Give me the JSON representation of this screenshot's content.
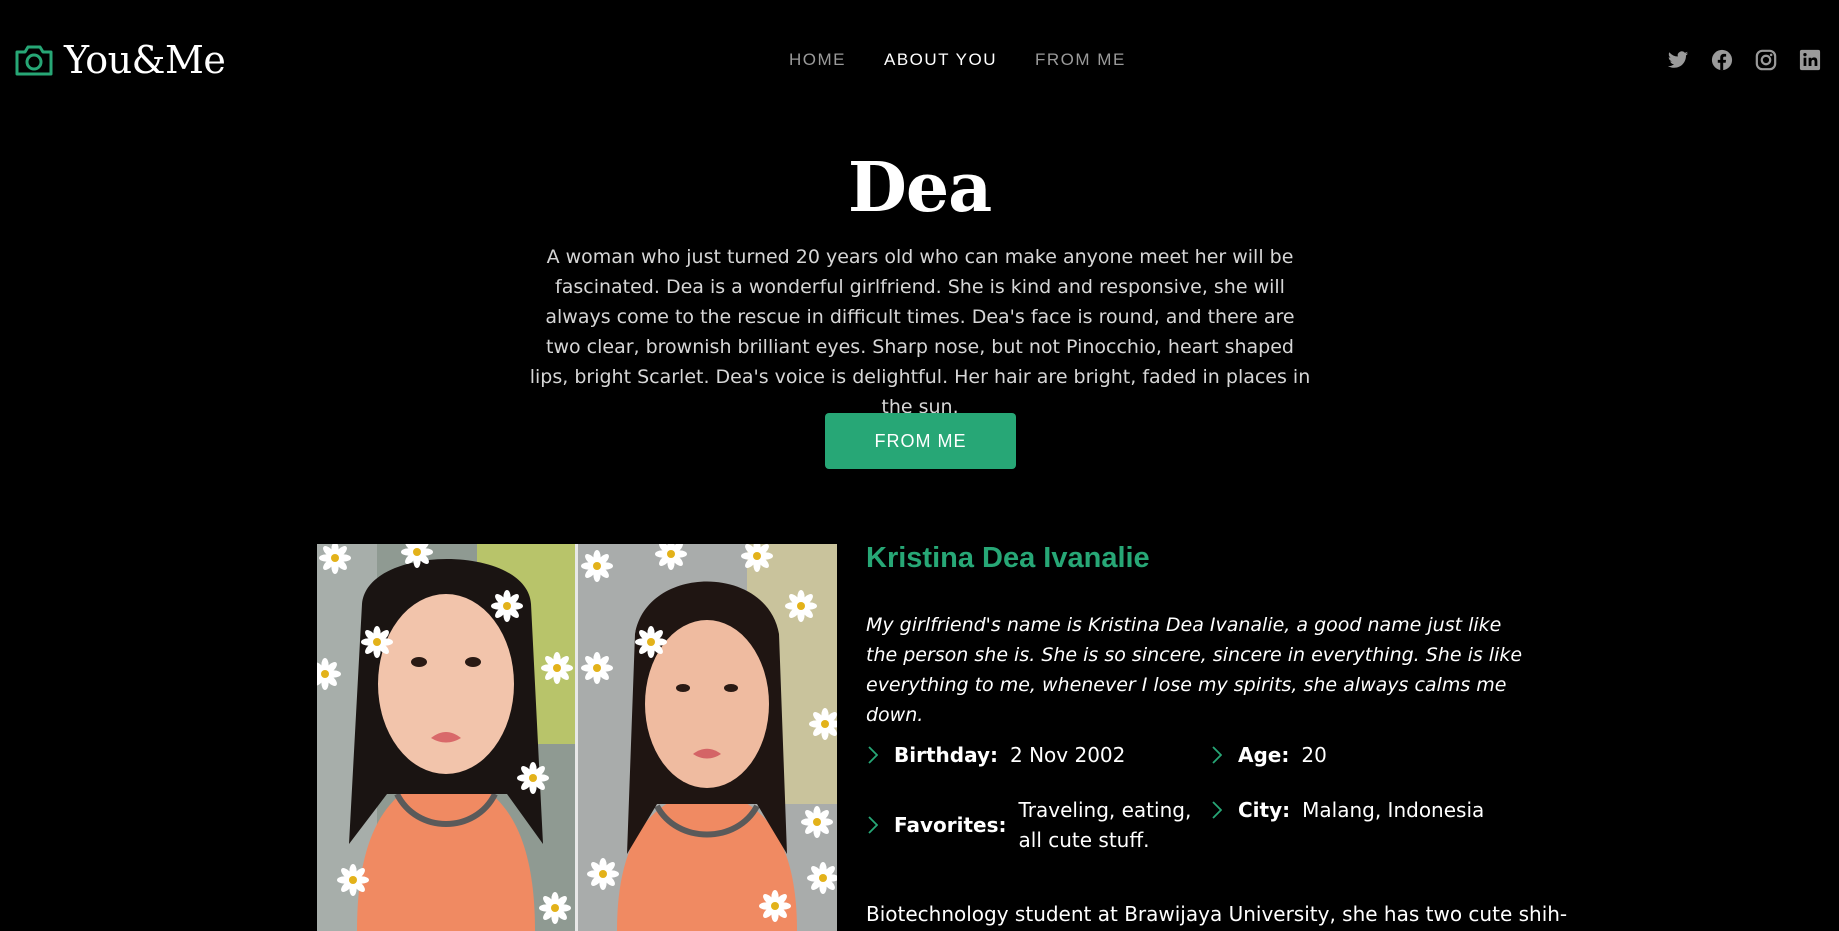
{
  "brand": {
    "name": "You&Me",
    "icon": "camera-icon",
    "accent": "#27a776"
  },
  "nav": {
    "items": [
      "HOME",
      "ABOUT YOU",
      "FROM ME"
    ],
    "active": "ABOUT YOU"
  },
  "socials": [
    "twitter-icon",
    "facebook-icon",
    "instagram-icon",
    "linkedin-icon"
  ],
  "hero": {
    "title": "Dea",
    "description": "A woman who just turned 20 years old who can make anyone meet her will be fascinated. Dea is a wonderful girlfriend. She is kind and responsive, she will always come to the rescue in difficult times. Dea's face is round, and there are two clear, brownish brilliant eyes. Sharp nose, but not Pinocchio, heart shaped lips, bright Scarlet. Dea's voice is delightful. Her hair are bright, faded in places in the sun.",
    "cta_label": "FROM ME"
  },
  "profile": {
    "name": "Kristina Dea Ivanalie",
    "bio": "My girlfriend's name is Kristina Dea Ivanalie, a good name just like the person she is. She is so sincere, sincere in everything. She is like everything to me, whenever I lose my spirits, she always calms me down.",
    "details": {
      "birthday": {
        "label": "Birthday:",
        "value": "2 Nov 2002"
      },
      "age": {
        "label": "Age:",
        "value": "20"
      },
      "favorites": {
        "label": "Favorites:",
        "value": "Traveling, eating, all cute stuff."
      },
      "city": {
        "label": "City:",
        "value": "Malang, Indonesia"
      }
    },
    "more": "Biotechnology student at Brawijaya University, she has two cute shih-"
  }
}
